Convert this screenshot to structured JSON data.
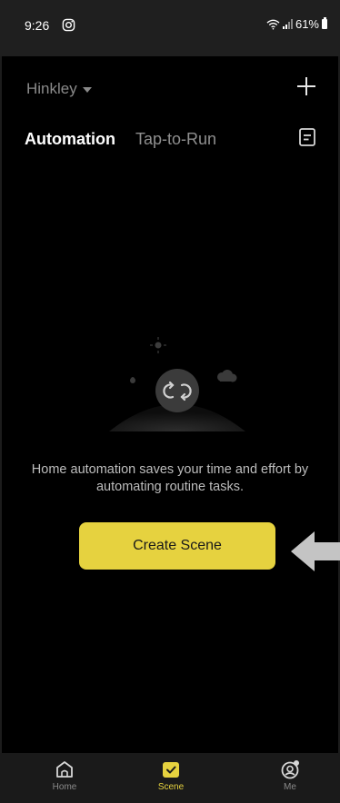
{
  "status_bar": {
    "time": "9:26",
    "battery": "61%"
  },
  "header": {
    "home_name": "Hinkley"
  },
  "tabs": [
    {
      "label": "Automation",
      "active": true
    },
    {
      "label": "Tap-to-Run",
      "active": false
    }
  ],
  "empty_state": {
    "message": "Home automation saves your time and effort by automating routine tasks.",
    "button_label": "Create Scene"
  },
  "bottom_nav": [
    {
      "label": "Home",
      "icon": "home-icon",
      "active": false
    },
    {
      "label": "Scene",
      "icon": "scene-check-icon",
      "active": true
    },
    {
      "label": "Me",
      "icon": "profile-icon",
      "active": false
    }
  ],
  "colors": {
    "accent": "#e6d23f",
    "background": "#000000",
    "nav_background": "#1a1a1a"
  }
}
